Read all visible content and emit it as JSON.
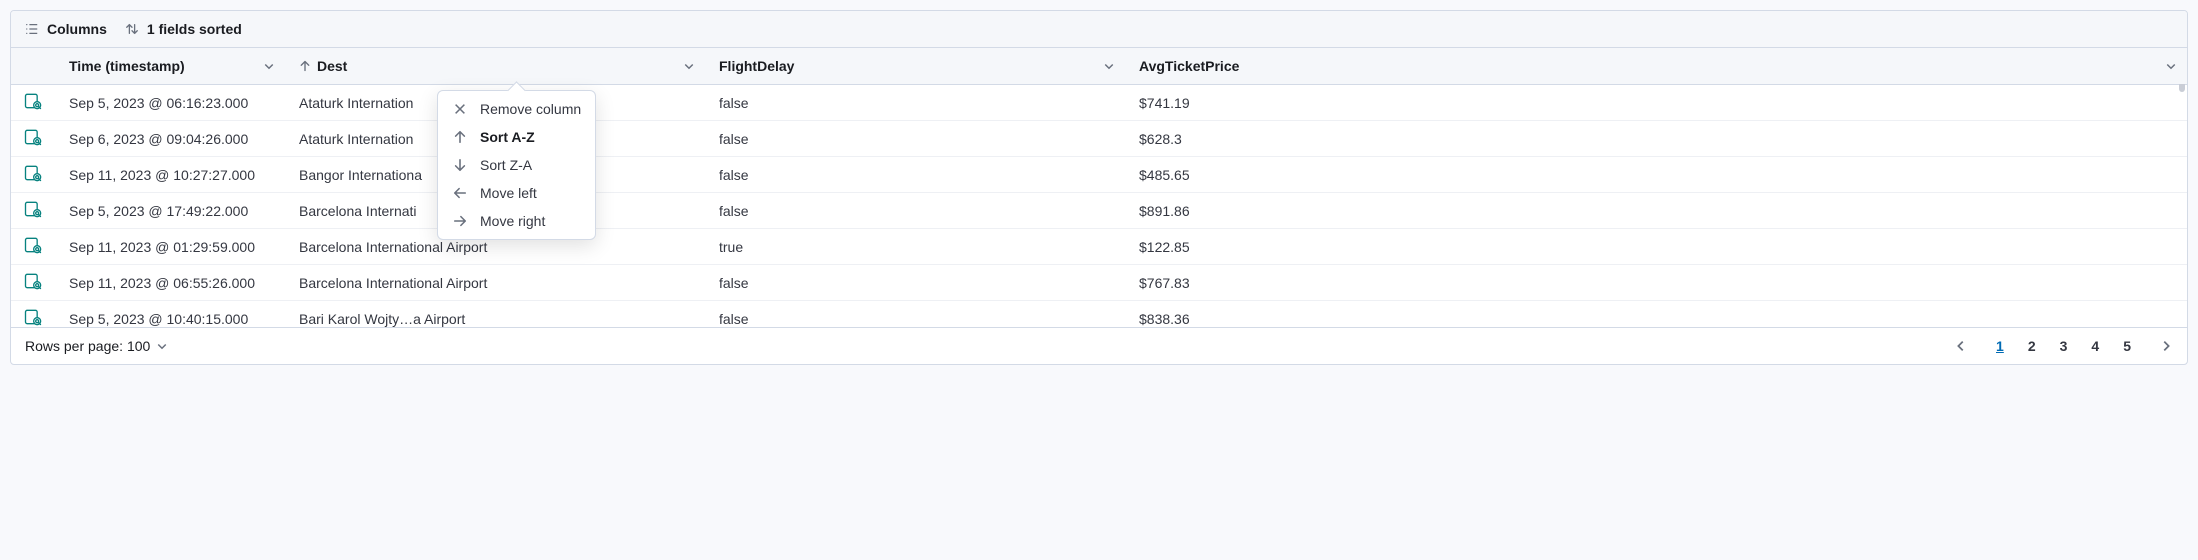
{
  "toolbar": {
    "columns_label": "Columns",
    "sort_label": "1 fields sorted"
  },
  "columns": {
    "time": "Time (timestamp)",
    "dest": "Dest",
    "flightdelay": "FlightDelay",
    "avgprice": "AvgTicketPrice"
  },
  "rows": [
    {
      "time": "Sep 5, 2023 @ 06:16:23.000",
      "dest": "Ataturk Internation",
      "delay": "false",
      "price": "$741.19"
    },
    {
      "time": "Sep 6, 2023 @ 09:04:26.000",
      "dest": "Ataturk Internation",
      "delay": "false",
      "price": "$628.3"
    },
    {
      "time": "Sep 11, 2023 @ 10:27:27.000",
      "dest": "Bangor Internationa",
      "delay": "false",
      "price": "$485.65"
    },
    {
      "time": "Sep 5, 2023 @ 17:49:22.000",
      "dest": "Barcelona Internati",
      "delay": "false",
      "price": "$891.86"
    },
    {
      "time": "Sep 11, 2023 @ 01:29:59.000",
      "dest": "Barcelona International Airport",
      "delay": "true",
      "price": "$122.85"
    },
    {
      "time": "Sep 11, 2023 @ 06:55:26.000",
      "dest": "Barcelona International Airport",
      "delay": "false",
      "price": "$767.83"
    },
    {
      "time": "Sep 5, 2023 @ 10:40:15.000",
      "dest": "Bari Karol Wojty…a Airport",
      "delay": "false",
      "price": "$838.36"
    }
  ],
  "menu": {
    "remove": "Remove column",
    "sort_az": "Sort A-Z",
    "sort_za": "Sort Z-A",
    "move_left": "Move left",
    "move_right": "Move right"
  },
  "footer": {
    "rows_per_page": "Rows per page: 100"
  },
  "pagination": {
    "pages": [
      "1",
      "2",
      "3",
      "4",
      "5"
    ],
    "active": "1"
  }
}
